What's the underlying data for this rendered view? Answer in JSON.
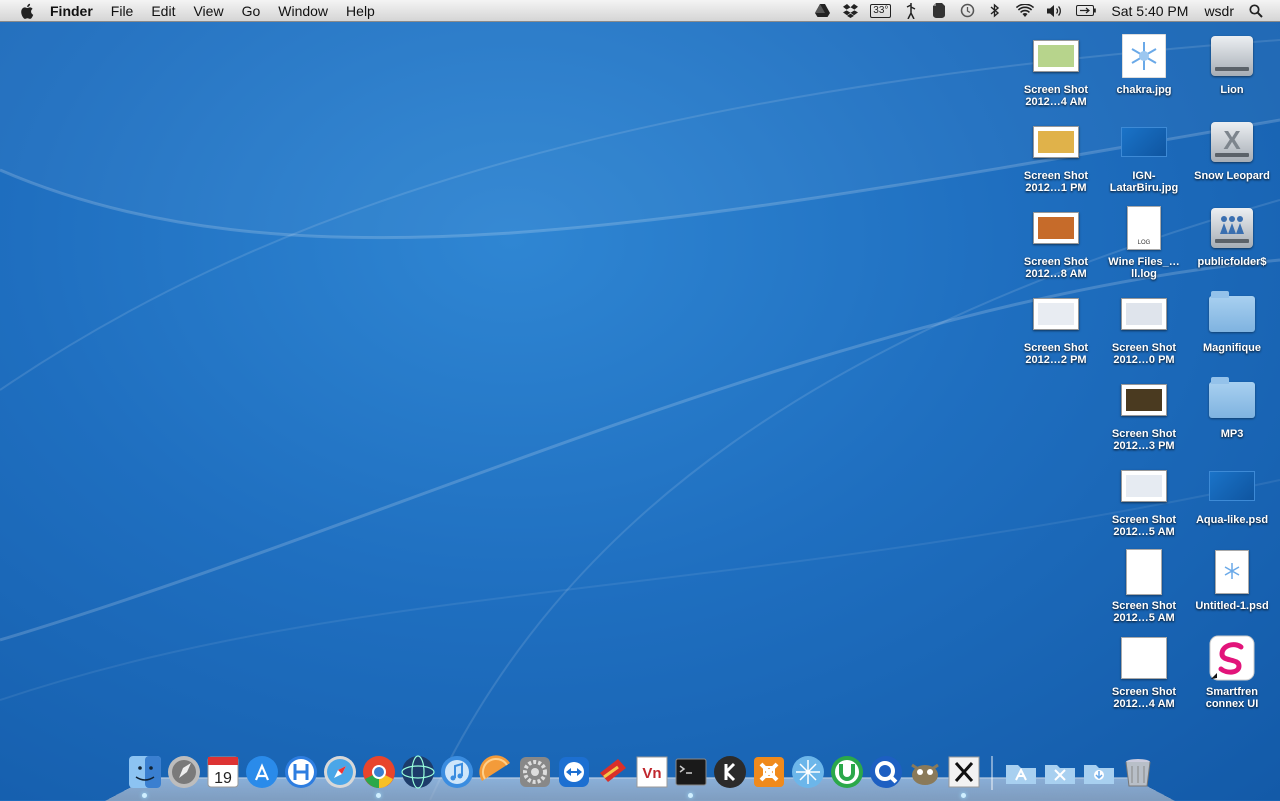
{
  "menubar": {
    "app_name": "Finder",
    "menus": [
      "File",
      "Edit",
      "View",
      "Go",
      "Window",
      "Help"
    ],
    "status_icons": [
      "drive-icon",
      "dropbox-icon",
      "temperature-icon",
      "growl-icon",
      "evernote-icon",
      "time-machine-icon",
      "bluetooth-icon",
      "wifi-icon",
      "volume-icon",
      "battery-icon"
    ],
    "temperature": "33°",
    "clock": "Sat 5:40 PM",
    "user": "wsdr"
  },
  "desktop": {
    "col1": [
      {
        "label": "Screen Shot 2012…4 AM",
        "kind": "shot",
        "color": "#b7d48c"
      },
      {
        "label": "Screen Shot 2012…1 PM",
        "kind": "shot",
        "color": "#e0b24a"
      },
      {
        "label": "Screen Shot 2012…8 AM",
        "kind": "shot",
        "color": "#c66b2a"
      },
      {
        "label": "Screen Shot 2012…2 PM",
        "kind": "shot",
        "color": "#e8ecf2"
      }
    ],
    "col2": [
      {
        "label": "chakra.jpg",
        "kind": "chakra"
      },
      {
        "label": "IGN-LatarBiru.jpg",
        "kind": "bluefile"
      },
      {
        "label": "Wine Files_…ll.log",
        "kind": "log",
        "badge": "LOG"
      },
      {
        "label": "Screen Shot 2012…0 PM",
        "kind": "shot",
        "color": "#dfe4ec"
      },
      {
        "label": "Screen Shot 2012…3 PM",
        "kind": "shot",
        "color": "#4a3a20"
      },
      {
        "label": "Screen Shot 2012…5 AM",
        "kind": "shot",
        "color": "#e6ebf2"
      },
      {
        "label": "Screen Shot 2012…5 AM",
        "kind": "doc"
      },
      {
        "label": "Screen Shot 2012…4 AM",
        "kind": "doc"
      }
    ],
    "col3": [
      {
        "label": "Lion",
        "kind": "drive"
      },
      {
        "label": "Snow Leopard",
        "kind": "drive-x"
      },
      {
        "label": "publicfolder$",
        "kind": "drive-share"
      },
      {
        "label": "Magnifique",
        "kind": "folder"
      },
      {
        "label": "MP3",
        "kind": "folder"
      },
      {
        "label": "Aqua-like.psd",
        "kind": "bluefile"
      },
      {
        "label": "Untitled-1.psd",
        "kind": "psd"
      },
      {
        "label": "Smartfren connex UI",
        "kind": "app-s"
      }
    ]
  },
  "dock": {
    "apps": [
      {
        "name": "finder-icon",
        "color": "#3a7fd0"
      },
      {
        "name": "launchpad-icon",
        "color": "#8d8d8d"
      },
      {
        "name": "calendar-icon",
        "color": "#ffffff",
        "text": "19"
      },
      {
        "name": "app-store-icon",
        "color": "#2a8bea"
      },
      {
        "name": "h-app-icon",
        "color": "#2d7de0"
      },
      {
        "name": "safari-icon",
        "color": "#4aa6e8"
      },
      {
        "name": "chrome-icon",
        "color": "#e8452c"
      },
      {
        "name": "network-globe-icon",
        "color": "#1d3c6a"
      },
      {
        "name": "itunes-icon",
        "color": "#3b8de0"
      },
      {
        "name": "orange-slice-icon",
        "color": "#f39b3a"
      },
      {
        "name": "system-preferences-icon",
        "color": "#888888"
      },
      {
        "name": "teamviewer-icon",
        "color": "#1c6fd1"
      },
      {
        "name": "cleanmymac-icon",
        "color": "#d9302a"
      },
      {
        "name": "vnc-icon",
        "color": "#c0272d"
      },
      {
        "name": "terminal-icon",
        "color": "#1a1a1a"
      },
      {
        "name": "k-app-icon",
        "color": "#2b2b2b"
      },
      {
        "name": "xampp-icon",
        "color": "#f08a1c"
      },
      {
        "name": "network-radar-icon",
        "color": "#6cb6ea"
      },
      {
        "name": "utorrent-icon",
        "color": "#2ba84a"
      },
      {
        "name": "quicktime-icon",
        "color": "#1d5fc2"
      },
      {
        "name": "gimp-icon",
        "color": "#8a7a5a"
      },
      {
        "name": "x11-icon",
        "color": "#f2f2f2"
      }
    ],
    "stacks": [
      {
        "name": "applications-stack-icon"
      },
      {
        "name": "utilities-stack-icon"
      },
      {
        "name": "downloads-stack-icon"
      },
      {
        "name": "trash-icon"
      }
    ]
  }
}
